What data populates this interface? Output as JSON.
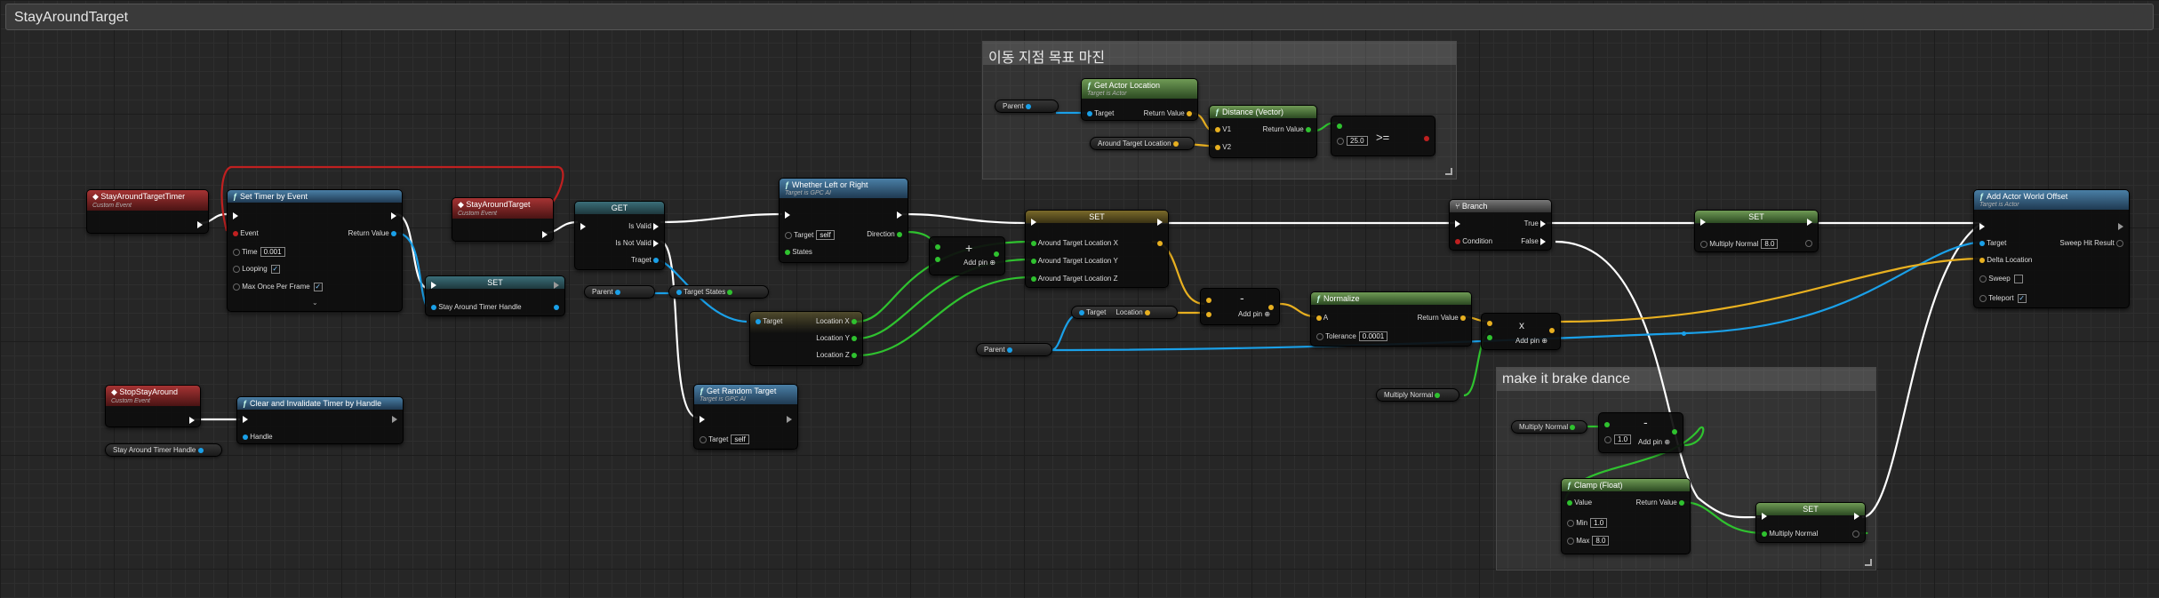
{
  "graph": {
    "title": "StayAroundTarget"
  },
  "comments": {
    "top": "이동 지점 목표 마진",
    "bottom": "make it brake dance"
  },
  "nodes": {
    "timer_event": {
      "title": "StayAroundTargetTimer",
      "subtitle": "Custom Event"
    },
    "set_timer": {
      "title": "Set Timer by Event",
      "event": "Event",
      "return": "Return Value",
      "time": "Time",
      "time_val": "0.001",
      "looping": "Looping",
      "max_once": "Max Once Per Frame"
    },
    "stay_event": {
      "title": "StayAroundTarget",
      "subtitle": "Custom Event"
    },
    "set_handle": {
      "title": "SET",
      "pin": "Stay Around Timer Handle"
    },
    "get": {
      "title": "GET",
      "valid": "Is Valid",
      "not_valid": "Is Not Valid",
      "target": "Traget"
    },
    "whether": {
      "title": "Whether Left or Right",
      "subtitle": "Target is GPC AI",
      "target": "Target",
      "target_val": "self",
      "direction": "Direction",
      "states": "States"
    },
    "break_vec": {
      "target": "Target",
      "lx": "Location X",
      "ly": "Location Y",
      "lz": "Location Z"
    },
    "get_random": {
      "title": "Get Random Target",
      "subtitle": "Target is GPC AI",
      "target": "Target",
      "target_val": "self"
    },
    "add_node": {
      "op": "+",
      "addpin": "Add pin"
    },
    "set_around": {
      "title": "SET",
      "x": "Around Target Location X",
      "y": "Around Target Location Y",
      "z": "Around Target Location Z"
    },
    "get_actor_loc": {
      "title": "Get Actor Location",
      "subtitle": "Target is Actor",
      "target": "Target",
      "ret": "Return Value"
    },
    "distance": {
      "title": "Distance (Vector)",
      "v1": "V1",
      "v2": "V2",
      "ret": "Return Value"
    },
    "compare": {
      "op": ">=",
      "val": "25.0"
    },
    "sub_node": {
      "op": "-",
      "addpin": "Add pin"
    },
    "target_loc": {
      "target": "Target",
      "location": "Location"
    },
    "normalize": {
      "title": "Normalize",
      "a": "A",
      "ret": "Return Value",
      "tol": "Tolerance",
      "tol_val": "0.0001"
    },
    "mul_node": {
      "op": "x",
      "addpin": "Add pin"
    },
    "branch": {
      "title": "Branch",
      "cond": "Condition",
      "true": "True",
      "false": "False"
    },
    "set_mult": {
      "title": "SET",
      "pin": "Multiply Normal",
      "val": "8.0"
    },
    "add_offset": {
      "title": "Add Actor World Offset",
      "subtitle": "Target is Actor",
      "target": "Target",
      "sweep_hit": "Sweep Hit Result",
      "delta": "Delta Location",
      "sweep": "Sweep",
      "teleport": "Teleport"
    },
    "stop_event": {
      "title": "StopStayAround",
      "subtitle": "Custom Event"
    },
    "clear_timer": {
      "title": "Clear and Invalidate Timer by Handle",
      "handle": "Handle"
    },
    "dec_node": {
      "op": "-",
      "val": "1.0",
      "addpin": "Add pin"
    },
    "clamp": {
      "title": "Clamp (Float)",
      "value": "Value",
      "ret": "Return Value",
      "min": "Min",
      "min_val": "1.0",
      "max": "Max",
      "max_val": "8.0"
    },
    "set_mult2": {
      "title": "SET",
      "pin": "Multiply Normal"
    }
  },
  "variables": {
    "parent": "Parent",
    "around_loc": "Around Target Location",
    "states": "States",
    "target": "Target",
    "handle": "Stay Around Timer Handle",
    "multiply": "Multiply Normal"
  },
  "colors": {
    "exec": "#ffffff",
    "object": "#1aa0e8",
    "float": "#2fc22f",
    "vector": "#e8b020",
    "event_wire": "#c02020"
  }
}
